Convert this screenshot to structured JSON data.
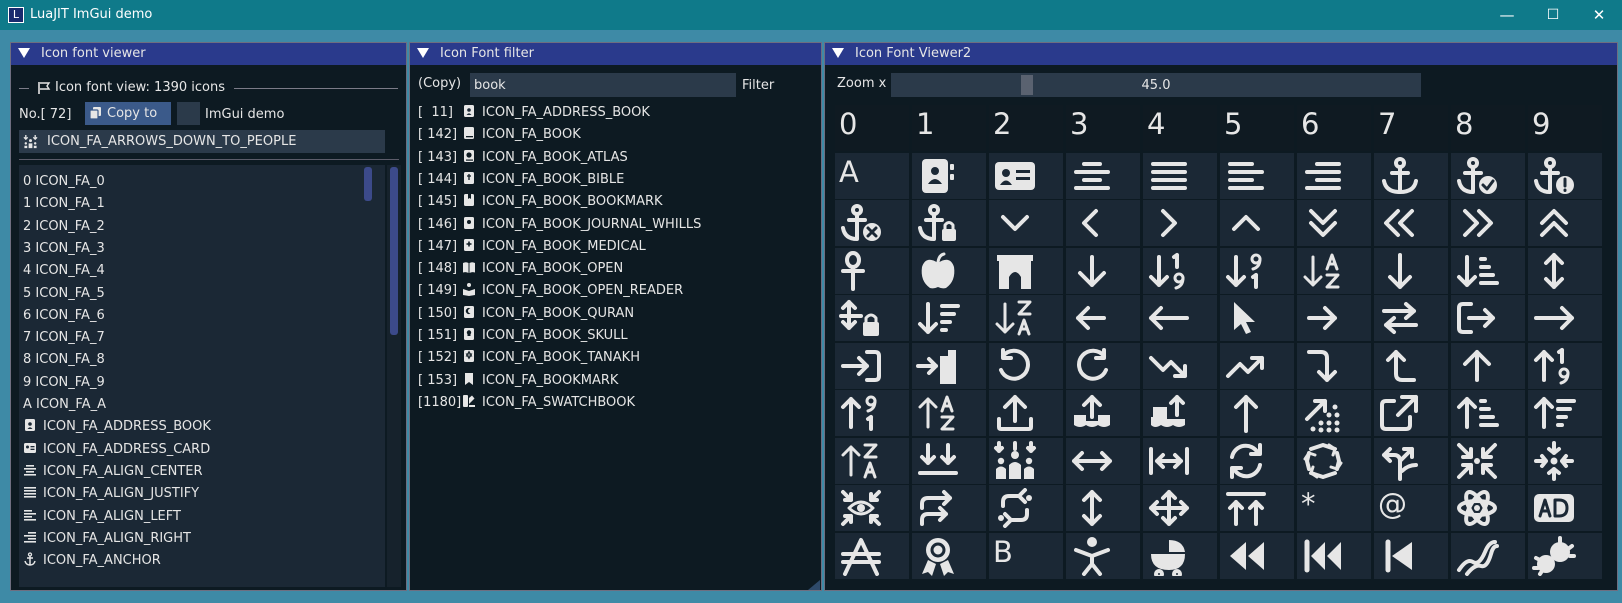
{
  "app": {
    "title": "LuaJIT ImGui demo",
    "icon_letter": "L",
    "minimize_glyph": "—",
    "maximize_glyph": "☐",
    "close_glyph": "✕"
  },
  "viewer": {
    "title": "Icon font viewer",
    "header": "Icon font view: 1390 icons",
    "no_label": "No.[  72]",
    "copy_button": "Copy to",
    "checkbox_label": "ImGui demo",
    "selected_name": "ICON_FA_ARROWS_DOWN_TO_PEOPLE",
    "items": [
      {
        "label": "0  ICON_FA_0",
        "icon": ""
      },
      {
        "label": "1  ICON_FA_1",
        "icon": ""
      },
      {
        "label": "2  ICON_FA_2",
        "icon": ""
      },
      {
        "label": "3  ICON_FA_3",
        "icon": ""
      },
      {
        "label": "4  ICON_FA_4",
        "icon": ""
      },
      {
        "label": "5  ICON_FA_5",
        "icon": ""
      },
      {
        "label": "6  ICON_FA_6",
        "icon": ""
      },
      {
        "label": "7  ICON_FA_7",
        "icon": ""
      },
      {
        "label": "8  ICON_FA_8",
        "icon": ""
      },
      {
        "label": "9  ICON_FA_9",
        "icon": ""
      },
      {
        "label": "A  ICON_FA_A",
        "icon": ""
      },
      {
        "label": "ICON_FA_ADDRESS_BOOK",
        "icon": "address-book-icon"
      },
      {
        "label": "ICON_FA_ADDRESS_CARD",
        "icon": "address-card-icon"
      },
      {
        "label": "ICON_FA_ALIGN_CENTER",
        "icon": "align-center-icon"
      },
      {
        "label": "ICON_FA_ALIGN_JUSTIFY",
        "icon": "align-justify-icon"
      },
      {
        "label": "ICON_FA_ALIGN_LEFT",
        "icon": "align-left-icon"
      },
      {
        "label": "ICON_FA_ALIGN_RIGHT",
        "icon": "align-right-icon"
      },
      {
        "label": "ICON_FA_ANCHOR",
        "icon": "anchor-icon"
      }
    ]
  },
  "filter": {
    "title": "Icon Font filter",
    "copy_label": "(Copy)",
    "input_value": "book",
    "filter_label": "Filter",
    "results": [
      {
        "index": "[  11]",
        "name": "ICON_FA_ADDRESS_BOOK",
        "icon": "address-book-icon"
      },
      {
        "index": "[ 142]",
        "name": "ICON_FA_BOOK",
        "icon": "book-icon"
      },
      {
        "index": "[ 143]",
        "name": "ICON_FA_BOOK_ATLAS",
        "icon": "book-atlas-icon"
      },
      {
        "index": "[ 144]",
        "name": "ICON_FA_BOOK_BIBLE",
        "icon": "book-bible-icon"
      },
      {
        "index": "[ 145]",
        "name": "ICON_FA_BOOK_BOOKMARK",
        "icon": "book-bookmark-icon"
      },
      {
        "index": "[ 146]",
        "name": "ICON_FA_BOOK_JOURNAL_WHILLS",
        "icon": "book-journal-icon"
      },
      {
        "index": "[ 147]",
        "name": "ICON_FA_BOOK_MEDICAL",
        "icon": "book-medical-icon"
      },
      {
        "index": "[ 148]",
        "name": "ICON_FA_BOOK_OPEN",
        "icon": "book-open-icon"
      },
      {
        "index": "[ 149]",
        "name": "ICON_FA_BOOK_OPEN_READER",
        "icon": "book-reader-icon"
      },
      {
        "index": "[ 150]",
        "name": "ICON_FA_BOOK_QURAN",
        "icon": "book-quran-icon"
      },
      {
        "index": "[ 151]",
        "name": "ICON_FA_BOOK_SKULL",
        "icon": "book-skull-icon"
      },
      {
        "index": "[ 152]",
        "name": "ICON_FA_BOOK_TANAKH",
        "icon": "book-tanakh-icon"
      },
      {
        "index": "[ 153]",
        "name": "ICON_FA_BOOKMARK",
        "icon": "bookmark-icon"
      },
      {
        "index": "[1180]",
        "name": "ICON_FA_SWATCHBOOK",
        "icon": "swatchbook-icon"
      }
    ]
  },
  "viewer2": {
    "title": "Icon Font Viewer2",
    "zoom_label": "Zoom x",
    "zoom_value": "45.0",
    "zoom_fraction": 0.25,
    "header_digits": [
      "0",
      "1",
      "2",
      "3",
      "4",
      "5",
      "6",
      "7",
      "8",
      "9"
    ],
    "rows": [
      [
        "A",
        "address-book-icon",
        "address-card-icon",
        "align-center-icon",
        "align-justify-icon",
        "align-left-icon",
        "align-right-icon",
        "anchor-icon",
        "anchor-check-icon",
        "anchor-alert-icon"
      ],
      [
        "anchor-x-icon",
        "anchor-lock-icon",
        "chevron-down-icon",
        "chevron-left-icon",
        "chevron-right-icon",
        "chevron-up-icon",
        "double-chevron-down-icon",
        "double-chevron-left-icon",
        "double-chevron-right-icon",
        "double-chevron-up-icon"
      ],
      [
        "ankh-icon",
        "apple-icon",
        "archway-icon",
        "arrow-down-icon",
        "arrow-down-1-9-icon",
        "arrow-down-9-1-icon",
        "arrow-down-a-z-icon",
        "arrow-down-long-icon",
        "arrow-down-short-wide-icon",
        "arrows-up-down-icon"
      ],
      [
        "arrow-lock-icon",
        "arrow-down-wide-short-icon",
        "arrow-down-z-a-icon",
        "arrow-left-icon",
        "arrow-left-long-icon",
        "arrow-pointer-icon",
        "arrow-right-icon",
        "arrow-right-arrow-left-icon",
        "arrow-right-from-bracket-icon",
        "arrow-right-long-icon"
      ],
      [
        "arrow-right-to-bracket-icon",
        "arrow-right-to-city-icon",
        "arrow-rotate-left-icon",
        "arrow-rotate-right-icon",
        "arrow-trend-down-icon",
        "arrow-trend-up-icon",
        "arrow-turn-down-icon",
        "arrow-turn-up-icon",
        "arrow-up-icon",
        "arrow-up-1-9-icon"
      ],
      [
        "arrow-up-9-1-icon",
        "arrow-up-a-z-icon",
        "arrow-up-from-bracket-icon",
        "arrow-up-from-ground-water-icon",
        "arrow-up-from-water-pump-icon",
        "arrow-up-long-icon",
        "arrow-up-right-dots-icon",
        "arrow-up-right-from-square-icon",
        "arrow-up-short-wide-icon",
        "arrow-up-wide-short-icon"
      ],
      [
        "arrow-up-z-a-icon",
        "arrows-down-to-line-icon",
        "arrows-down-to-people-icon",
        "arrows-left-right-icon",
        "arrows-left-right-to-line-icon",
        "arrows-rotate-icon",
        "arrows-spin-icon",
        "arrows-split-up-and-left-icon",
        "arrows-to-circle-icon",
        "arrows-to-dot-icon"
      ],
      [
        "arrows-to-eye-icon",
        "arrows-turn-right-icon",
        "arrows-turn-to-dots-icon",
        "arrows-up-down-icon",
        "arrows-up-down-left-right-icon",
        "arrows-up-to-line-icon",
        "asterisk-icon",
        "at-icon",
        "atom-icon",
        "audio-description-icon"
      ],
      [
        "austral-sign-icon",
        "award-icon",
        "B",
        "baby-icon",
        "baby-carriage-icon",
        "backward-icon",
        "backward-fast-icon",
        "backward-step-icon",
        "bacon-icon",
        "bacteria-icon"
      ]
    ],
    "text_glyphs": {
      "asterisk-icon": "*",
      "at-icon": "@",
      "B": "B",
      "A": "A"
    }
  }
}
